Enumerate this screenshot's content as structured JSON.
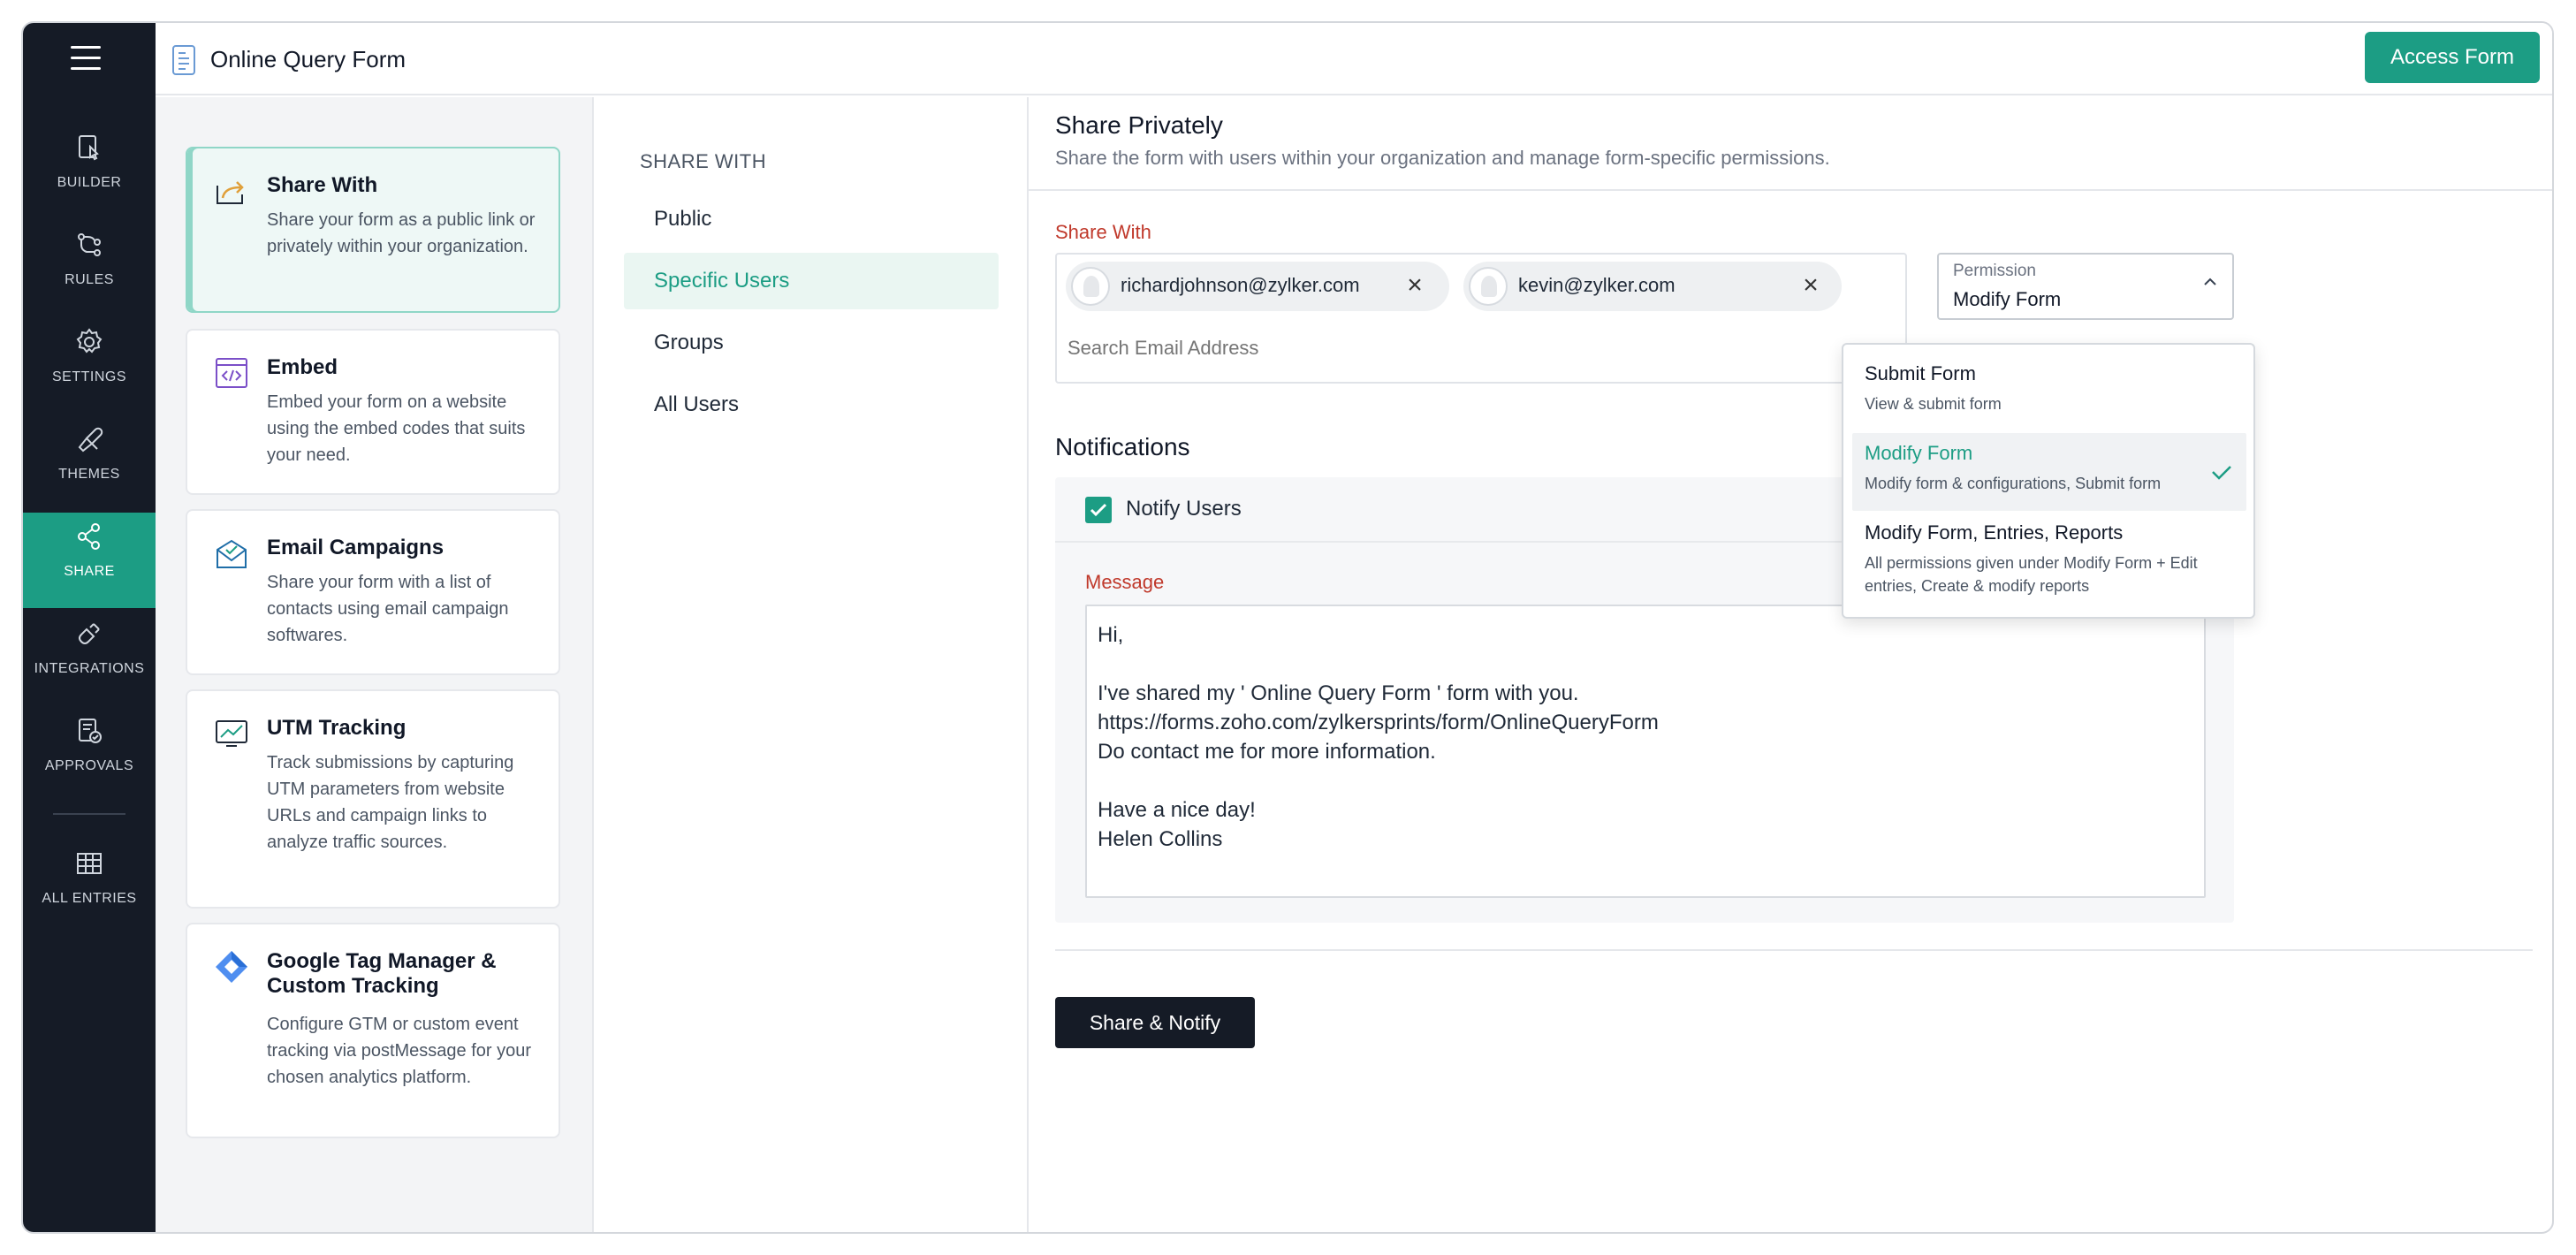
{
  "header": {
    "title": "Online Query Form",
    "access_label": "Access Form"
  },
  "rail": {
    "items": [
      {
        "label": "BUILDER",
        "icon": "builder-icon"
      },
      {
        "label": "RULES",
        "icon": "rules-icon"
      },
      {
        "label": "SETTINGS",
        "icon": "gear-icon"
      },
      {
        "label": "THEMES",
        "icon": "themes-icon"
      },
      {
        "label": "SHARE",
        "icon": "share-icon",
        "active": true
      },
      {
        "label": "INTEGRATIONS",
        "icon": "integrations-icon"
      },
      {
        "label": "APPROVALS",
        "icon": "approvals-icon"
      },
      {
        "label": "ALL ENTRIES",
        "icon": "grid-icon"
      }
    ]
  },
  "cards": [
    {
      "title": "Share With",
      "desc": "Share your form as a public link or privately within your organization.",
      "icon": "share-with-icon",
      "active": true
    },
    {
      "title": "Embed",
      "desc": "Embed your form on a website using the embed codes that suits your need.",
      "icon": "embed-icon"
    },
    {
      "title": "Email Campaigns",
      "desc": "Share your form with a list of contacts using email campaign softwares.",
      "icon": "email-campaign-icon"
    },
    {
      "title": "UTM Tracking",
      "desc": "Track submissions by capturing UTM parameters from website URLs and campaign links to analyze traffic sources.",
      "icon": "utm-tracking-icon"
    },
    {
      "title": "Google Tag Manager & Custom Tracking",
      "desc": "Configure GTM or custom event tracking via postMessage for your chosen analytics platform.",
      "icon": "gtm-icon"
    }
  ],
  "share_with": {
    "heading": "SHARE WITH",
    "options": [
      "Public",
      "Specific Users",
      "Groups",
      "All Users"
    ],
    "active": "Specific Users"
  },
  "main": {
    "title": "Share Privately",
    "subtitle": "Share the form with users within your organization and manage form-specific permissions.",
    "share_with_label": "Share With",
    "chips": [
      "richardjohnson@zylker.com",
      "kevin@zylker.com"
    ],
    "search_placeholder": "Search Email Address",
    "permission_label": "Permission",
    "permission_value": "Modify Form",
    "notifications_title": "Notifications",
    "notify_label": "Notify Users",
    "notify_checked": true,
    "message_label": "Message",
    "message_lines": [
      "Hi,",
      "",
      "I've shared my ' Online Query Form ' form with you.",
      "https://forms.zoho.com/zylkersprints/form/OnlineQueryForm",
      "Do contact me for more information.",
      "",
      "Have a nice day!",
      "Helen Collins"
    ],
    "share_button": "Share & Notify"
  },
  "permission_dropdown": {
    "items": [
      {
        "title": "Submit Form",
        "desc": "View & submit form"
      },
      {
        "title": "Modify Form",
        "desc": "Modify form & configurations, Submit form",
        "selected": true
      },
      {
        "title": "Modify Form, Entries, Reports",
        "desc": "All permissions given under Modify Form + Edit entries, Create & modify reports"
      }
    ]
  },
  "colors": {
    "accent": "#1c9d84",
    "rail": "#151b26",
    "label_red": "#c0392b"
  }
}
